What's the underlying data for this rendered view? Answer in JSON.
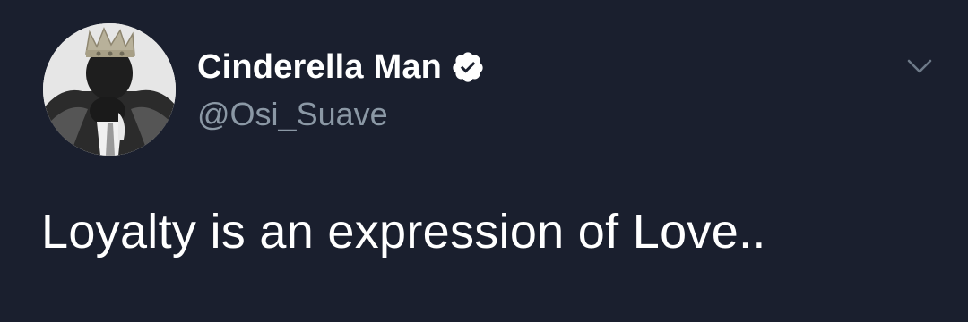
{
  "tweet": {
    "author": {
      "display_name": "Cinderella Man",
      "handle": "@Osi_Suave",
      "verified": true,
      "avatar_icon": "profile-photo-crowned-man"
    },
    "text": "Loyalty is an expression of Love..",
    "menu_icon": "chevron-down-icon"
  },
  "colors": {
    "background": "#1a1f2e",
    "name": "#ffffff",
    "handle": "#8b98a5",
    "text": "#ffffff",
    "verified_badge": "#ffffff",
    "chevron": "#6e7a88"
  }
}
